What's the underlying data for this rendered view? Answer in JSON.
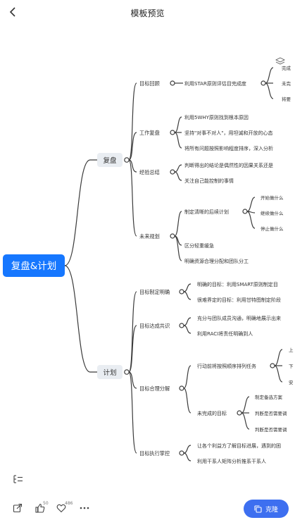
{
  "header": {
    "title": "模板预览"
  },
  "mindmap": {
    "root": "复盘&计划",
    "review": {
      "label": "复盘",
      "goal_review": {
        "label": "目标回顾",
        "item": "利用STAR原则评估目完成度",
        "subs": [
          "完成",
          "未完",
          "将要"
        ]
      },
      "work_review": {
        "label": "工作复盘",
        "items": [
          "利用5WHY原则找到根本原因",
          "坚持\"对事不对人\"，用坦诚和开放的心态",
          "将所有问题按照影响程度排序，深入分析"
        ]
      },
      "experience": {
        "label": "经验总结",
        "items": [
          "判断得出的结论是偶然性的因果关系还是",
          "关注自己能控制的事情"
        ]
      },
      "future_plan": {
        "label": "未来规划",
        "followup": "制定清晰的后续计划",
        "followup_subs": [
          "开始做什么",
          "继续做什么",
          "停止做什么"
        ],
        "items": [
          "区分轻重缓急",
          "明确资源合理分配和团队分工"
        ]
      }
    },
    "plan": {
      "label": "计划",
      "goal_clarify": {
        "label": "目标制定明确",
        "items": [
          "明确的目标：利用SMART原则制定目",
          "很难界定的目标：利用甘特图制定阶段"
        ]
      },
      "goal_consensus": {
        "label": "目标达成共识",
        "items": [
          "充分与团队成员沟通，明确地展示出来",
          "利用RACI将责任明确到人"
        ]
      },
      "goal_breakdown": {
        "label": "目标合理分解",
        "order": "行动前将按照顺序排列任务",
        "order_subs": [
          "上",
          "下",
          "安"
        ],
        "unfinished": "未完成的目标",
        "unfinished_subs": [
          "制定备选方案",
          "判断是否需要调",
          "判断是否需要调"
        ]
      },
      "goal_exec": {
        "label": "目标执行掌控",
        "items": [
          "让各个利益方了解目标进展，遇到的困",
          "利用干系人矩阵分析推系干系人"
        ]
      }
    }
  },
  "toolbar": {
    "like_count": "50",
    "fav_count": "486",
    "clone_label": "克隆"
  }
}
